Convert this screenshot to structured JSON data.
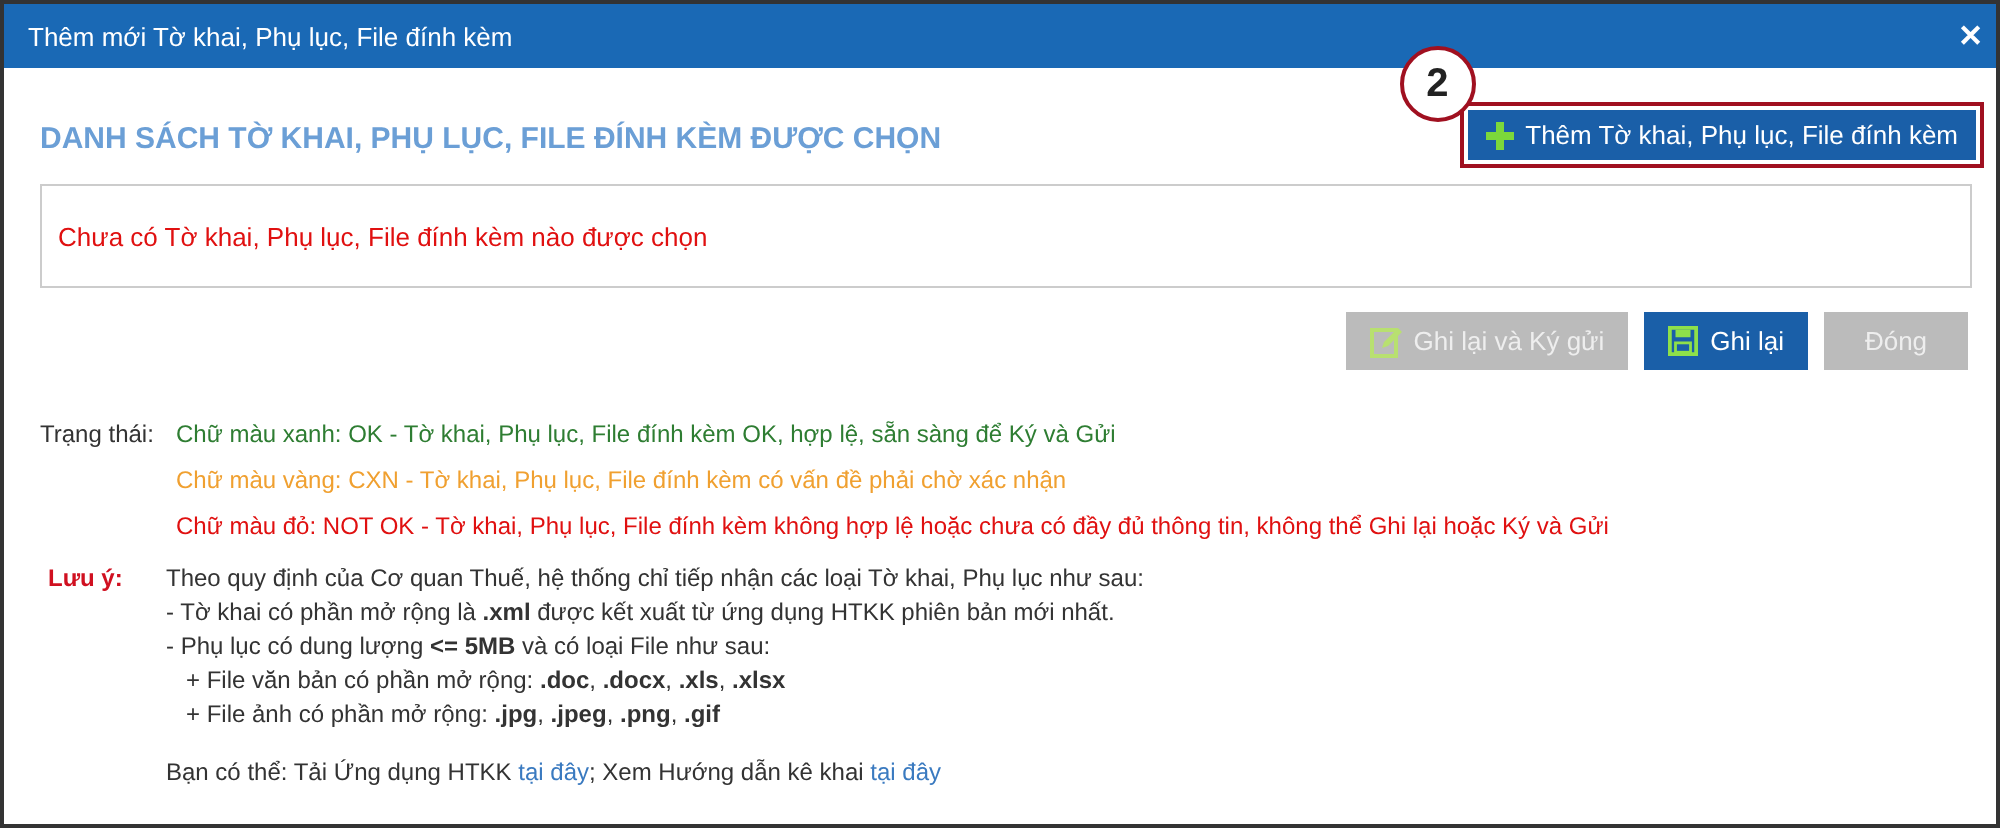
{
  "window": {
    "title": "Thêm mới Tờ khai, Phụ lục, File đính kèm",
    "close": "✕"
  },
  "callout": {
    "label": "2"
  },
  "heading": "DANH SÁCH TỜ KHAI, PHỤ LỤC, FILE ĐÍNH KÈM ĐƯỢC CHỌN",
  "add_button": {
    "label": "Thêm Tờ khai, Phụ lục, File đính kèm",
    "highlighted": true
  },
  "empty_message": "Chưa có Tờ khai, Phụ lục, File đính kèm nào được chọn",
  "buttons": [
    {
      "label": "Ghi lại và Ký gửi",
      "kind": "sign",
      "disabled": true
    },
    {
      "label": "Ghi lại",
      "kind": "save",
      "disabled": false
    },
    {
      "label": "Đóng",
      "kind": "plain",
      "disabled": true
    }
  ],
  "status": {
    "label": "Trạng thái:",
    "items": [
      {
        "text": "Chữ màu xanh: OK - Tờ khai, Phụ lục, File đính kèm OK, hợp lệ, sẵn sàng để Ký và Gửi",
        "color": "#2e7d32"
      },
      {
        "text": "Chữ màu vàng: CXN - Tờ khai, Phụ lục, File đính kèm có vấn đề phải chờ xác nhận",
        "color": "#f0a030"
      },
      {
        "text": "Chữ màu đỏ: NOT OK - Tờ khai, Phụ lục, File đính kèm không hợp lệ hoặc chưa có đầy đủ thông tin, không thể Ghi lại hoặc Ký và Gửi",
        "color": "#e01010"
      }
    ]
  },
  "notes": {
    "label": "Lưu ý:",
    "lines": [
      {
        "text": "Theo quy định của Cơ quan Thuế, hệ thống chỉ tiếp nhận các loại Tờ khai, Phụ lục như sau:",
        "kind": "plain"
      },
      {
        "text": "- Tờ khai có phần mở rộng là **.xml** được kết xuất từ ứng dụng HTKK phiên bản mới nhất.",
        "kind": "plain"
      },
      {
        "text": "- Phụ lục có dung lượng **<= 5MB** và có loại File như sau:",
        "kind": "plain"
      },
      {
        "text": "+ File văn bản có phần mở rộng: **.doc**, **.docx**, **.xls**, **.xlsx**",
        "kind": "sub"
      },
      {
        "text": "+ File ảnh có phần mở rộng: **.jpg**, **.jpeg**, **.png**, **.gif**",
        "kind": "sub"
      }
    ]
  },
  "footer": [
    {
      "kind": "text",
      "text": "Bạn có thể: Tải Ứng dụng HTKK"
    },
    {
      "kind": "link",
      "text": "tại đây"
    },
    {
      "kind": "text",
      "text": "; Xem Hướng dẫn kê khai"
    },
    {
      "kind": "link",
      "text": "tại đây"
    }
  ]
}
